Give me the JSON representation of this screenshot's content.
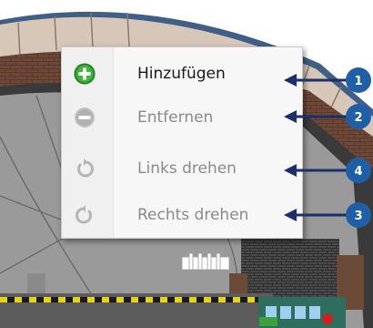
{
  "context_menu": {
    "items": [
      {
        "label": "Hinzufügen",
        "icon": "add-icon",
        "enabled": true,
        "callout": "1"
      },
      {
        "label": "Entfernen",
        "icon": "remove-icon",
        "enabled": false,
        "callout": "2"
      },
      {
        "label": "Links drehen",
        "icon": "rotate-left-icon",
        "enabled": false,
        "callout": "4"
      },
      {
        "label": "Rechts drehen",
        "icon": "rotate-right-icon",
        "enabled": false,
        "callout": "3"
      }
    ]
  },
  "colors": {
    "callout_blue": "#1f5fa8",
    "arrow_navy": "#1c2f6b",
    "add_green": "#2f9a2f",
    "disabled_gray": "#b5b5b5"
  }
}
